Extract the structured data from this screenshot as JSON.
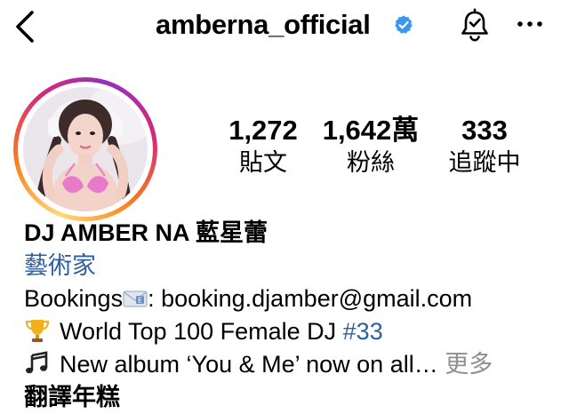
{
  "header": {
    "username": "amberna_official"
  },
  "profile": {
    "stats": [
      {
        "value": "1,272",
        "label": "貼文"
      },
      {
        "value": "1,642萬",
        "label": "粉絲"
      },
      {
        "value": "333",
        "label": "追蹤中"
      }
    ],
    "display_name": "DJ AMBER NA 藍星蕾",
    "category": "藝術家",
    "bio": {
      "bookings_prefix": "Bookings",
      "bookings_suffix": ": booking.djamber@gmail.com",
      "line2_text": "World Top 100 Female DJ ",
      "line2_link": "#33",
      "line3_text": "New album ‘You & Me’ now on all…",
      "more_label": "更多",
      "translate_label": "翻譯年糕"
    }
  },
  "colors": {
    "link": "#2f5f9c",
    "verified": "#3897f0",
    "muted": "#8e8e8e"
  },
  "icons": [
    "back-arrow-icon",
    "verified-badge-icon",
    "bell-icon",
    "more-options-icon",
    "envelope-emoji",
    "trophy-emoji",
    "music-notes-emoji"
  ]
}
